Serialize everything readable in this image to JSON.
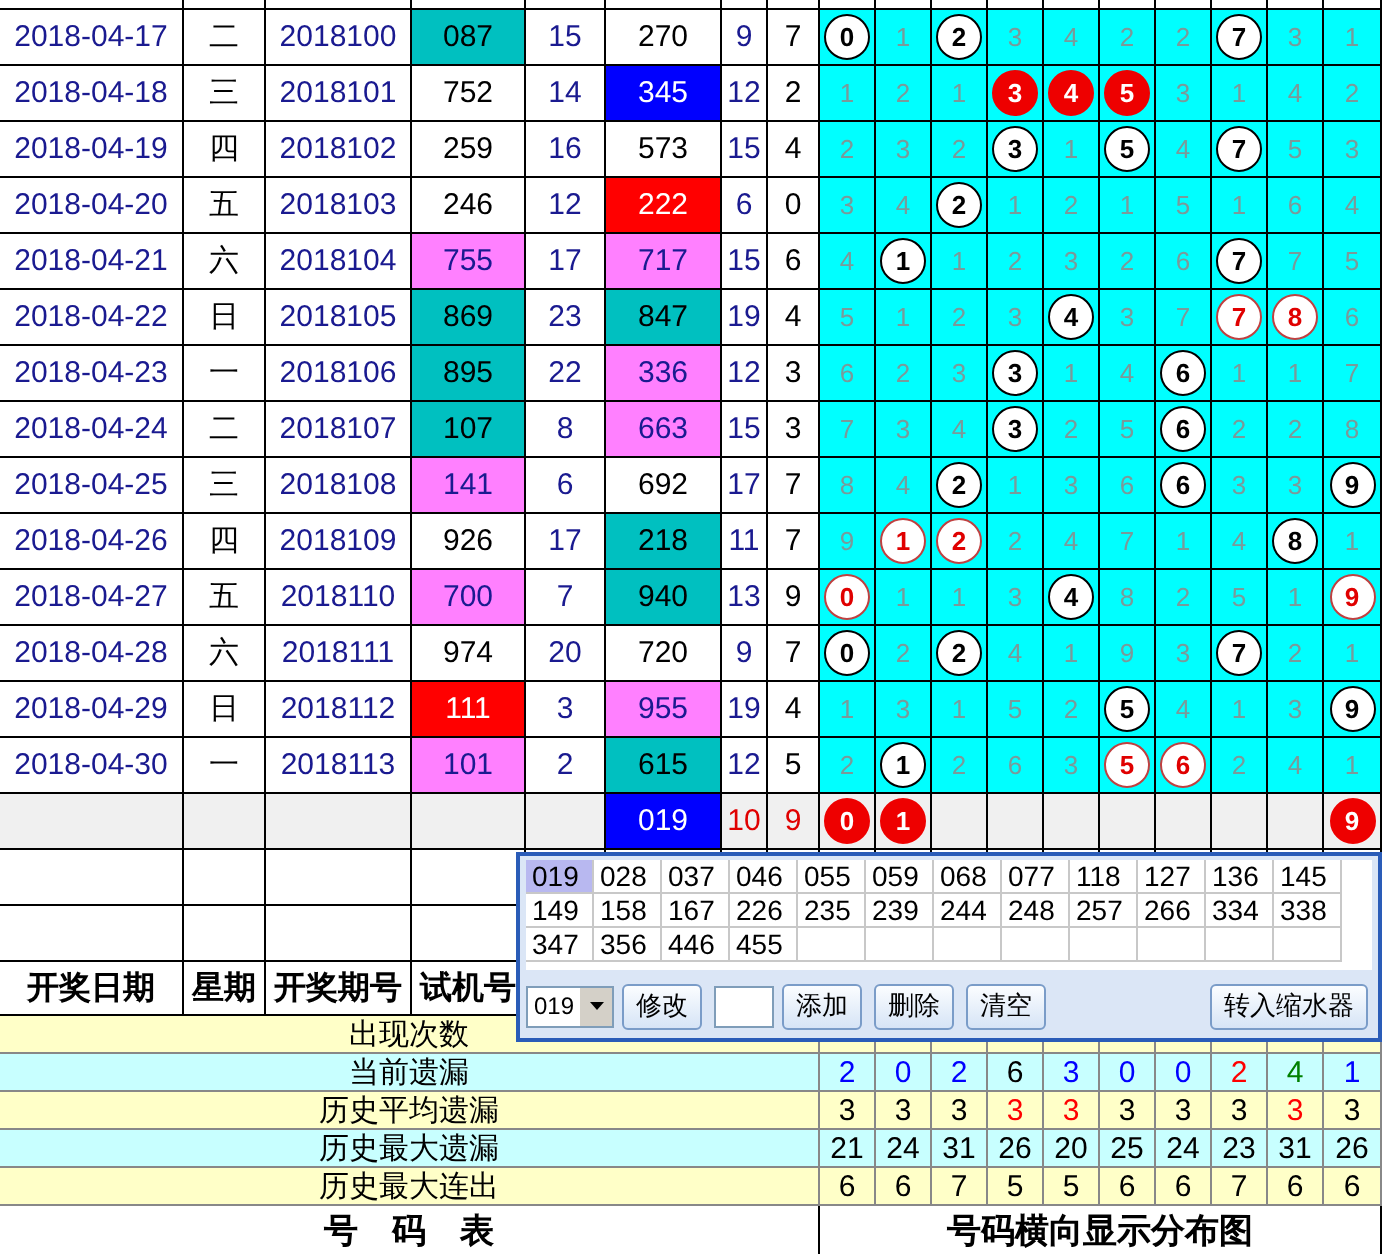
{
  "draws": [
    {
      "date": "2018-04-17",
      "weekday": "二",
      "issue": "2018100",
      "test_number": {
        "text": "087",
        "color": "#00c0c0"
      },
      "column_5": "15",
      "column_6": {
        "text": "270",
        "color": "#ffffff"
      },
      "column_7": "9",
      "column_8": "7",
      "grid": [
        {
          "text": "0",
          "kind": "hit"
        },
        {
          "text": "1",
          "kind": "miss"
        },
        {
          "text": "2",
          "kind": "hit"
        },
        {
          "text": "3",
          "kind": "miss"
        },
        {
          "text": "4",
          "kind": "miss"
        },
        {
          "text": "2",
          "kind": "miss"
        },
        {
          "text": "2",
          "kind": "miss"
        },
        {
          "text": "7",
          "kind": "hit"
        },
        {
          "text": "3",
          "kind": "miss"
        },
        {
          "text": "1",
          "kind": "miss"
        }
      ]
    },
    {
      "date": "2018-04-18",
      "weekday": "三",
      "issue": "2018101",
      "test_number": {
        "text": "752",
        "color": "#ffffff"
      },
      "column_5": "14",
      "column_6": {
        "text": "345",
        "color": "#0000ff"
      },
      "column_7": "12",
      "column_8": "2",
      "grid": [
        {
          "text": "1",
          "kind": "miss"
        },
        {
          "text": "2",
          "kind": "miss"
        },
        {
          "text": "1",
          "kind": "miss"
        },
        {
          "text": "3",
          "kind": "hit-filled"
        },
        {
          "text": "4",
          "kind": "hit-filled"
        },
        {
          "text": "5",
          "kind": "hit-filled"
        },
        {
          "text": "3",
          "kind": "miss"
        },
        {
          "text": "1",
          "kind": "miss"
        },
        {
          "text": "4",
          "kind": "miss"
        },
        {
          "text": "2",
          "kind": "miss"
        }
      ]
    },
    {
      "date": "2018-04-19",
      "weekday": "四",
      "issue": "2018102",
      "test_number": {
        "text": "259",
        "color": "#ffffff"
      },
      "column_5": "16",
      "column_6": {
        "text": "573",
        "color": "#ffffff"
      },
      "column_7": "15",
      "column_8": "4",
      "grid": [
        {
          "text": "2",
          "kind": "miss"
        },
        {
          "text": "3",
          "kind": "miss"
        },
        {
          "text": "2",
          "kind": "miss"
        },
        {
          "text": "3",
          "kind": "hit"
        },
        {
          "text": "1",
          "kind": "miss"
        },
        {
          "text": "5",
          "kind": "hit"
        },
        {
          "text": "4",
          "kind": "miss"
        },
        {
          "text": "7",
          "kind": "hit"
        },
        {
          "text": "5",
          "kind": "miss"
        },
        {
          "text": "3",
          "kind": "miss"
        }
      ]
    },
    {
      "date": "2018-04-20",
      "weekday": "五",
      "issue": "2018103",
      "test_number": {
        "text": "246",
        "color": "#ffffff"
      },
      "column_5": "12",
      "column_6": {
        "text": "222",
        "color": "#ff0000"
      },
      "column_7": "6",
      "column_8": "0",
      "grid": [
        {
          "text": "3",
          "kind": "miss"
        },
        {
          "text": "4",
          "kind": "miss"
        },
        {
          "text": "2",
          "kind": "hit"
        },
        {
          "text": "1",
          "kind": "miss"
        },
        {
          "text": "2",
          "kind": "miss"
        },
        {
          "text": "1",
          "kind": "miss"
        },
        {
          "text": "5",
          "kind": "miss"
        },
        {
          "text": "1",
          "kind": "miss"
        },
        {
          "text": "6",
          "kind": "miss"
        },
        {
          "text": "4",
          "kind": "miss"
        }
      ]
    },
    {
      "date": "2018-04-21",
      "weekday": "六",
      "issue": "2018104",
      "test_number": {
        "text": "755",
        "color": "#ff80ff"
      },
      "column_5": "17",
      "column_6": {
        "text": "717",
        "color": "#ff80ff"
      },
      "column_7": "15",
      "column_8": "6",
      "grid": [
        {
          "text": "4",
          "kind": "miss"
        },
        {
          "text": "1",
          "kind": "hit"
        },
        {
          "text": "1",
          "kind": "miss"
        },
        {
          "text": "2",
          "kind": "miss"
        },
        {
          "text": "3",
          "kind": "miss"
        },
        {
          "text": "2",
          "kind": "miss"
        },
        {
          "text": "6",
          "kind": "miss"
        },
        {
          "text": "7",
          "kind": "hit"
        },
        {
          "text": "7",
          "kind": "miss"
        },
        {
          "text": "5",
          "kind": "miss"
        }
      ]
    },
    {
      "date": "2018-04-22",
      "weekday": "日",
      "issue": "2018105",
      "test_number": {
        "text": "869",
        "color": "#00c0c0"
      },
      "column_5": "23",
      "column_6": {
        "text": "847",
        "color": "#00c0c0"
      },
      "column_7": "19",
      "column_8": "4",
      "grid": [
        {
          "text": "5",
          "kind": "miss"
        },
        {
          "text": "1",
          "kind": "miss"
        },
        {
          "text": "2",
          "kind": "miss"
        },
        {
          "text": "3",
          "kind": "miss"
        },
        {
          "text": "4",
          "kind": "hit"
        },
        {
          "text": "3",
          "kind": "miss"
        },
        {
          "text": "7",
          "kind": "miss"
        },
        {
          "text": "7",
          "kind": "hit-red"
        },
        {
          "text": "8",
          "kind": "hit-red"
        },
        {
          "text": "6",
          "kind": "miss"
        }
      ]
    },
    {
      "date": "2018-04-23",
      "weekday": "一",
      "issue": "2018106",
      "test_number": {
        "text": "895",
        "color": "#00c0c0"
      },
      "column_5": "22",
      "column_6": {
        "text": "336",
        "color": "#ff80ff"
      },
      "column_7": "12",
      "column_8": "3",
      "grid": [
        {
          "text": "6",
          "kind": "miss"
        },
        {
          "text": "2",
          "kind": "miss"
        },
        {
          "text": "3",
          "kind": "miss"
        },
        {
          "text": "3",
          "kind": "hit"
        },
        {
          "text": "1",
          "kind": "miss"
        },
        {
          "text": "4",
          "kind": "miss"
        },
        {
          "text": "6",
          "kind": "hit"
        },
        {
          "text": "1",
          "kind": "miss"
        },
        {
          "text": "1",
          "kind": "miss"
        },
        {
          "text": "7",
          "kind": "miss"
        }
      ]
    },
    {
      "date": "2018-04-24",
      "weekday": "二",
      "issue": "2018107",
      "test_number": {
        "text": "107",
        "color": "#00c0c0"
      },
      "column_5": "8",
      "column_6": {
        "text": "663",
        "color": "#ff80ff"
      },
      "column_7": "15",
      "column_8": "3",
      "grid": [
        {
          "text": "7",
          "kind": "miss"
        },
        {
          "text": "3",
          "kind": "miss"
        },
        {
          "text": "4",
          "kind": "miss"
        },
        {
          "text": "3",
          "kind": "hit"
        },
        {
          "text": "2",
          "kind": "miss"
        },
        {
          "text": "5",
          "kind": "miss"
        },
        {
          "text": "6",
          "kind": "hit"
        },
        {
          "text": "2",
          "kind": "miss"
        },
        {
          "text": "2",
          "kind": "miss"
        },
        {
          "text": "8",
          "kind": "miss"
        }
      ]
    },
    {
      "date": "2018-04-25",
      "weekday": "三",
      "issue": "2018108",
      "test_number": {
        "text": "141",
        "color": "#ff80ff"
      },
      "column_5": "6",
      "column_6": {
        "text": "692",
        "color": "#ffffff"
      },
      "column_7": "17",
      "column_8": "7",
      "grid": [
        {
          "text": "8",
          "kind": "miss"
        },
        {
          "text": "4",
          "kind": "miss"
        },
        {
          "text": "2",
          "kind": "hit"
        },
        {
          "text": "1",
          "kind": "miss"
        },
        {
          "text": "3",
          "kind": "miss"
        },
        {
          "text": "6",
          "kind": "miss"
        },
        {
          "text": "6",
          "kind": "hit"
        },
        {
          "text": "3",
          "kind": "miss"
        },
        {
          "text": "3",
          "kind": "miss"
        },
        {
          "text": "9",
          "kind": "hit"
        }
      ]
    },
    {
      "date": "2018-04-26",
      "weekday": "四",
      "issue": "2018109",
      "test_number": {
        "text": "926",
        "color": "#ffffff"
      },
      "column_5": "17",
      "column_6": {
        "text": "218",
        "color": "#00c0c0"
      },
      "column_7": "11",
      "column_8": "7",
      "grid": [
        {
          "text": "9",
          "kind": "miss"
        },
        {
          "text": "1",
          "kind": "hit-red"
        },
        {
          "text": "2",
          "kind": "hit-red"
        },
        {
          "text": "2",
          "kind": "miss"
        },
        {
          "text": "4",
          "kind": "miss"
        },
        {
          "text": "7",
          "kind": "miss"
        },
        {
          "text": "1",
          "kind": "miss"
        },
        {
          "text": "4",
          "kind": "miss"
        },
        {
          "text": "8",
          "kind": "hit"
        },
        {
          "text": "1",
          "kind": "miss"
        }
      ]
    },
    {
      "date": "2018-04-27",
      "weekday": "五",
      "issue": "2018110",
      "test_number": {
        "text": "700",
        "color": "#ff80ff"
      },
      "column_5": "7",
      "column_6": {
        "text": "940",
        "color": "#00c0c0"
      },
      "column_7": "13",
      "column_8": "9",
      "grid": [
        {
          "text": "0",
          "kind": "hit-red"
        },
        {
          "text": "1",
          "kind": "miss"
        },
        {
          "text": "1",
          "kind": "miss"
        },
        {
          "text": "3",
          "kind": "miss"
        },
        {
          "text": "4",
          "kind": "hit"
        },
        {
          "text": "8",
          "kind": "miss"
        },
        {
          "text": "2",
          "kind": "miss"
        },
        {
          "text": "5",
          "kind": "miss"
        },
        {
          "text": "1",
          "kind": "miss"
        },
        {
          "text": "9",
          "kind": "hit-red"
        }
      ]
    },
    {
      "date": "2018-04-28",
      "weekday": "六",
      "issue": "2018111",
      "test_number": {
        "text": "974",
        "color": "#ffffff"
      },
      "column_5": "20",
      "column_6": {
        "text": "720",
        "color": "#ffffff"
      },
      "column_7": "9",
      "column_8": "7",
      "grid": [
        {
          "text": "0",
          "kind": "hit"
        },
        {
          "text": "2",
          "kind": "miss"
        },
        {
          "text": "2",
          "kind": "hit"
        },
        {
          "text": "4",
          "kind": "miss"
        },
        {
          "text": "1",
          "kind": "miss"
        },
        {
          "text": "9",
          "kind": "miss"
        },
        {
          "text": "3",
          "kind": "miss"
        },
        {
          "text": "7",
          "kind": "hit"
        },
        {
          "text": "2",
          "kind": "miss"
        },
        {
          "text": "1",
          "kind": "miss"
        }
      ]
    },
    {
      "date": "2018-04-29",
      "weekday": "日",
      "issue": "2018112",
      "test_number": {
        "text": "111",
        "color": "#ff0000"
      },
      "column_5": "3",
      "column_6": {
        "text": "955",
        "color": "#ff80ff"
      },
      "column_7": "19",
      "column_8": "4",
      "grid": [
        {
          "text": "1",
          "kind": "miss"
        },
        {
          "text": "3",
          "kind": "miss"
        },
        {
          "text": "1",
          "kind": "miss"
        },
        {
          "text": "5",
          "kind": "miss"
        },
        {
          "text": "2",
          "kind": "miss"
        },
        {
          "text": "5",
          "kind": "hit"
        },
        {
          "text": "4",
          "kind": "miss"
        },
        {
          "text": "1",
          "kind": "miss"
        },
        {
          "text": "3",
          "kind": "miss"
        },
        {
          "text": "9",
          "kind": "hit"
        }
      ]
    },
    {
      "date": "2018-04-30",
      "weekday": "一",
      "issue": "2018113",
      "test_number": {
        "text": "101",
        "color": "#ff80ff"
      },
      "column_5": "2",
      "column_6": {
        "text": "615",
        "color": "#00c0c0"
      },
      "column_7": "12",
      "column_8": "5",
      "grid": [
        {
          "text": "2",
          "kind": "miss"
        },
        {
          "text": "1",
          "kind": "hit"
        },
        {
          "text": "2",
          "kind": "miss"
        },
        {
          "text": "6",
          "kind": "miss"
        },
        {
          "text": "3",
          "kind": "miss"
        },
        {
          "text": "5",
          "kind": "hit-red"
        },
        {
          "text": "6",
          "kind": "hit-red"
        },
        {
          "text": "2",
          "kind": "miss"
        },
        {
          "text": "4",
          "kind": "miss"
        },
        {
          "text": "1",
          "kind": "miss"
        }
      ]
    }
  ],
  "forecast": {
    "column_6": {
      "text": "019",
      "color": "#0000ff"
    },
    "column_7": "10",
    "column_8": "9",
    "grid": [
      {
        "text": "0",
        "kind": "hit-filled"
      },
      {
        "text": "1",
        "kind": "hit-filled"
      },
      {
        "kind": "empty"
      },
      {
        "kind": "empty"
      },
      {
        "kind": "empty"
      },
      {
        "kind": "empty"
      },
      {
        "kind": "empty"
      },
      {
        "kind": "empty"
      },
      {
        "kind": "empty"
      },
      {
        "text": "9",
        "kind": "hit-filled"
      }
    ]
  },
  "header": [
    "开奖日期",
    "星期",
    "开奖期号",
    "试机号"
  ],
  "stats": [
    {
      "label": "出现次数"
    },
    {
      "label": "当前遗漏",
      "values": [
        {
          "text": "2",
          "color": "#0000ff"
        },
        {
          "text": "0",
          "color": "#0000ff"
        },
        {
          "text": "2",
          "color": "#0000ff"
        },
        {
          "text": "6",
          "color": "#000000"
        },
        {
          "text": "3",
          "color": "#0000ff"
        },
        {
          "text": "0",
          "color": "#0000ff"
        },
        {
          "text": "0",
          "color": "#0000ff"
        },
        {
          "text": "2",
          "color": "#ff0000"
        },
        {
          "text": "4",
          "color": "#008000"
        },
        {
          "text": "1",
          "color": "#0000ff"
        }
      ]
    },
    {
      "label": "历史平均遗漏",
      "values": [
        {
          "text": "3",
          "color": "#000000"
        },
        {
          "text": "3",
          "color": "#000000"
        },
        {
          "text": "3",
          "color": "#000000"
        },
        {
          "text": "3",
          "color": "#ff0000"
        },
        {
          "text": "3",
          "color": "#ff0000"
        },
        {
          "text": "3",
          "color": "#000000"
        },
        {
          "text": "3",
          "color": "#000000"
        },
        {
          "text": "3",
          "color": "#000000"
        },
        {
          "text": "3",
          "color": "#ff0000"
        },
        {
          "text": "3",
          "color": "#000000"
        }
      ]
    },
    {
      "label": "历史最大遗漏",
      "values": [
        {
          "text": "21",
          "color": "#000000"
        },
        {
          "text": "24",
          "color": "#000000"
        },
        {
          "text": "31",
          "color": "#000000"
        },
        {
          "text": "26",
          "color": "#000000"
        },
        {
          "text": "20",
          "color": "#000000"
        },
        {
          "text": "25",
          "color": "#000000"
        },
        {
          "text": "24",
          "color": "#000000"
        },
        {
          "text": "23",
          "color": "#000000"
        },
        {
          "text": "31",
          "color": "#000000"
        },
        {
          "text": "26",
          "color": "#000000"
        }
      ]
    },
    {
      "label": "历史最大连出",
      "values": [
        {
          "text": "6",
          "color": "#000000"
        },
        {
          "text": "6",
          "color": "#000000"
        },
        {
          "text": "7",
          "color": "#000000"
        },
        {
          "text": "5",
          "color": "#000000"
        },
        {
          "text": "5",
          "color": "#000000"
        },
        {
          "text": "6",
          "color": "#000000"
        },
        {
          "text": "6",
          "color": "#000000"
        },
        {
          "text": "7",
          "color": "#000000"
        },
        {
          "text": "6",
          "color": "#000000"
        },
        {
          "text": "6",
          "color": "#000000"
        }
      ]
    }
  ],
  "footer": [
    "号　码　表",
    "号码横向显示分布图"
  ],
  "popup": {
    "combos": [
      {
        "text": "019",
        "selected": true
      },
      {
        "text": "028",
        "selected": false
      },
      {
        "text": "037",
        "selected": false
      },
      {
        "text": "046",
        "selected": false
      },
      {
        "text": "055",
        "selected": false
      },
      {
        "text": "059",
        "selected": false
      },
      {
        "text": "068",
        "selected": false
      },
      {
        "text": "077",
        "selected": false
      },
      {
        "text": "118",
        "selected": false
      },
      {
        "text": "127",
        "selected": false
      },
      {
        "text": "136",
        "selected": false
      },
      {
        "text": "145",
        "selected": false
      },
      {
        "text": "149",
        "selected": false
      },
      {
        "text": "158",
        "selected": false
      },
      {
        "text": "167",
        "selected": false
      },
      {
        "text": "226",
        "selected": false
      },
      {
        "text": "235",
        "selected": false
      },
      {
        "text": "239",
        "selected": false
      },
      {
        "text": "244",
        "selected": false
      },
      {
        "text": "248",
        "selected": false
      },
      {
        "text": "257",
        "selected": false
      },
      {
        "text": "266",
        "selected": false
      },
      {
        "text": "334",
        "selected": false
      },
      {
        "text": "338",
        "selected": false
      },
      {
        "text": "347",
        "selected": false
      },
      {
        "text": "356",
        "selected": false
      },
      {
        "text": "446",
        "selected": false
      },
      {
        "text": "455",
        "selected": false
      }
    ],
    "controls": [
      {
        "kind": "select",
        "value": "019"
      },
      {
        "kind": "button",
        "label": "修改"
      },
      {
        "kind": "input"
      },
      {
        "kind": "button",
        "label": "添加"
      },
      {
        "kind": "button",
        "label": "删除"
      },
      {
        "kind": "button",
        "label": "清空"
      }
    ],
    "transfer_button": "转入缩水器"
  }
}
